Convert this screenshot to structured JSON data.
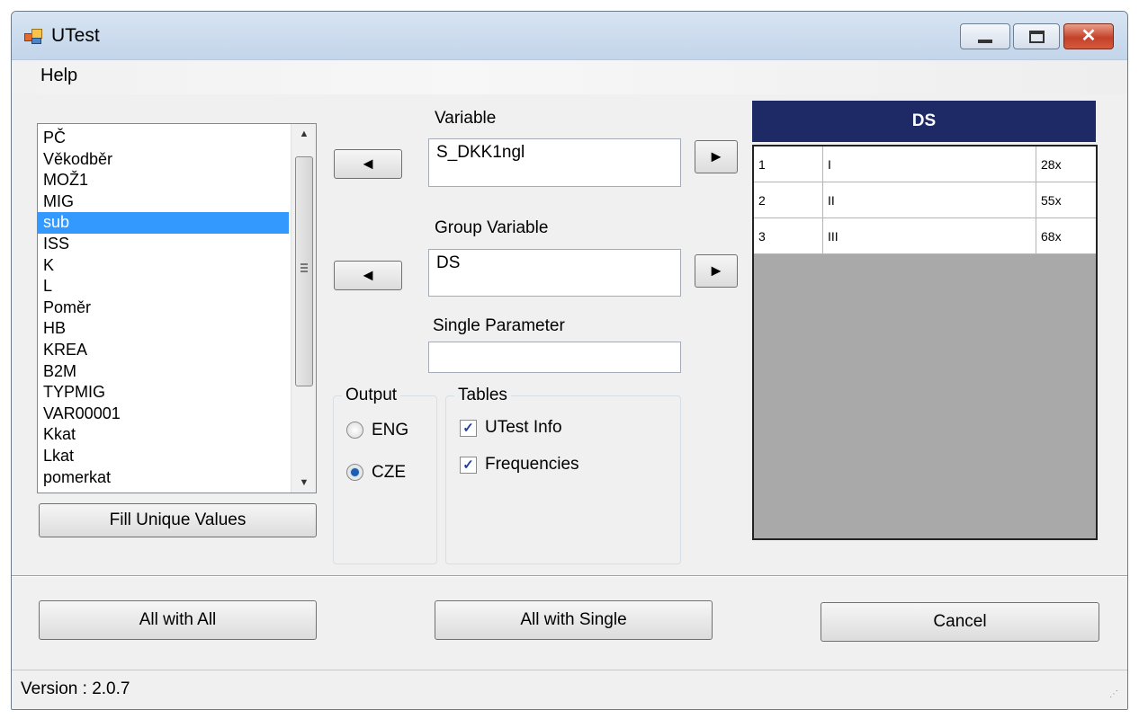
{
  "window": {
    "title": "UTest",
    "controls": {
      "minimize": "minimize",
      "maximize": "maximize",
      "close": "✕"
    }
  },
  "menu": {
    "items": [
      {
        "label": "Help"
      }
    ]
  },
  "listbox": {
    "items": [
      "PČ",
      "Věkodběr",
      "MOŽ1",
      "MIG",
      "sub",
      "ISS",
      "K",
      "L",
      "Poměr",
      "HB",
      "KREA",
      "B2M",
      "TYPMIG",
      "VAR00001",
      "Kkat",
      "Lkat",
      "pomerkat"
    ],
    "selected": "sub"
  },
  "buttons": {
    "fill_unique": "Fill Unique Values",
    "all_with_all": "All with All",
    "all_with_single": "All with Single",
    "cancel": "Cancel",
    "left_arrow": "◄",
    "right_arrow": "►"
  },
  "fields": {
    "variable": {
      "label": "Variable",
      "value": "S_DKK1ngl"
    },
    "group_variable": {
      "label": "Group Variable",
      "value": "DS"
    },
    "single_parameter": {
      "label": "Single Parameter",
      "value": ""
    }
  },
  "output": {
    "title": "Output",
    "options": [
      {
        "label": "ENG",
        "checked": false
      },
      {
        "label": "CZE",
        "checked": true
      }
    ]
  },
  "tables": {
    "title": "Tables",
    "options": [
      {
        "label": "UTest Info",
        "checked": true
      },
      {
        "label": "Frequencies",
        "checked": true
      }
    ]
  },
  "ds_table": {
    "header": "DS",
    "rows": [
      [
        "1",
        "I",
        "28x"
      ],
      [
        "2",
        "II",
        "55x"
      ],
      [
        "3",
        "III",
        "68x"
      ]
    ]
  },
  "status": {
    "version": "Version : 2.0.7",
    "grip": "⋰"
  },
  "colors": {
    "ds_header_bg": "#1d2a66",
    "selection": "#3399ff",
    "close_button": "#c4412a",
    "grid_background": "#a9a9a9"
  },
  "icons": [
    "app-icon",
    "minimize-icon",
    "maximize-icon",
    "close-icon",
    "left-arrow-icon",
    "right-arrow-icon",
    "scroll-up-icon",
    "scroll-down-icon",
    "checkmark-icon",
    "resize-grip-icon"
  ]
}
